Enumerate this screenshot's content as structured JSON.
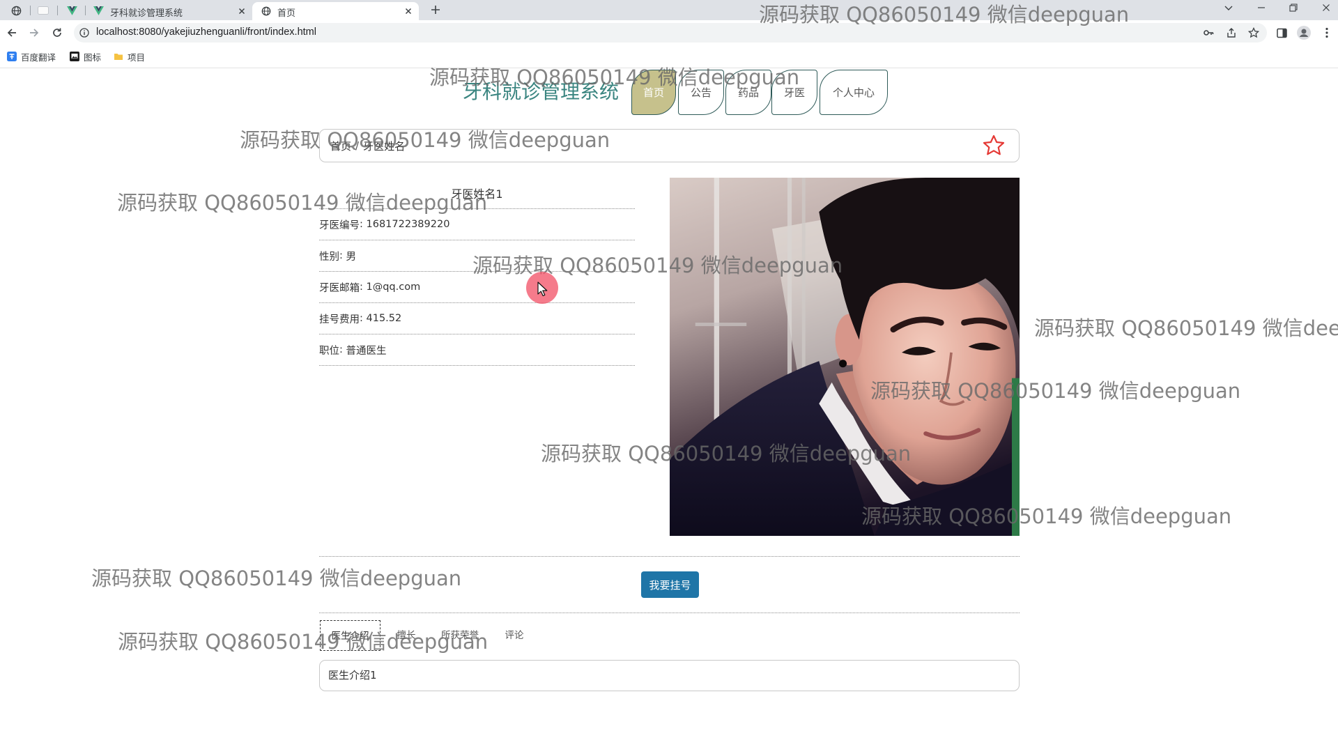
{
  "browser": {
    "pinned_tabs": [
      {
        "icon": "globe-icon"
      },
      {
        "icon": "blank-page-icon"
      },
      {
        "icon": "vue-logo-icon"
      }
    ],
    "tabs": [
      {
        "title": "牙科就诊管理系统",
        "icon": "vue-logo-icon",
        "active": false
      },
      {
        "title": "首页",
        "icon": "globe-icon",
        "active": true
      }
    ],
    "address_bar": {
      "url": "localhost:8080/yakejiuzhenguanli/front/index.html",
      "icon": "info-icon"
    },
    "bookmarks": [
      {
        "label": "百度翻译",
        "icon": "baidu-translate-icon"
      },
      {
        "label": "图标",
        "icon": "image-icon"
      },
      {
        "label": "项目",
        "icon": "folder-icon"
      }
    ]
  },
  "site": {
    "title": "牙科就诊管理系统",
    "nav": [
      {
        "label": "首页",
        "active": true
      },
      {
        "label": "公告",
        "active": false
      },
      {
        "label": "药品",
        "active": false
      },
      {
        "label": "牙医",
        "active": false
      },
      {
        "label": "个人中心",
        "active": false
      }
    ]
  },
  "breadcrumb": {
    "home": "首页",
    "separator": "/",
    "current": "牙医姓名",
    "favorite_icon": "star-outline-icon"
  },
  "doctor": {
    "name": "牙医姓名1",
    "separator": ": ",
    "fields": [
      {
        "label": "牙医编号",
        "value": "1681722389220"
      },
      {
        "label": "性别",
        "value": "男"
      },
      {
        "label": "牙医邮箱",
        "value": "1@qq.com"
      },
      {
        "label": "挂号费用",
        "value": "415.52"
      },
      {
        "label": "职位",
        "value": "普通医生"
      }
    ]
  },
  "actions": {
    "register_button": "我要挂号"
  },
  "detail_tabs": {
    "items": [
      {
        "label": "医生介绍",
        "active": true
      },
      {
        "label": "擅长",
        "active": false
      },
      {
        "label": "所获荣誉",
        "active": false
      },
      {
        "label": "评论",
        "active": false
      }
    ],
    "content": "医生介绍1"
  },
  "watermark": "源码获取 QQ86050149 微信deepguan",
  "colors": {
    "title": "#3a8580",
    "nav_active_fill": "#c6c18c",
    "nav_border": "#2e5a58",
    "primary_button": "#1f75a7",
    "favorite_star": "#e53935",
    "click_indicator": "#f2566a"
  }
}
